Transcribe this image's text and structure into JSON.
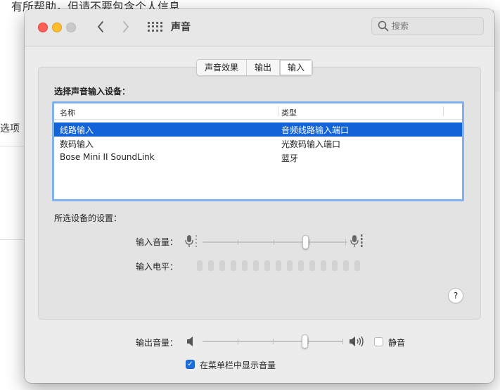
{
  "background": {
    "top_text": "有所帮助，但请不要包含个人信息",
    "left_text": "选项"
  },
  "window": {
    "title": "声音",
    "search_placeholder": "搜索"
  },
  "tabs": [
    {
      "label": "声音效果",
      "active": false
    },
    {
      "label": "输出",
      "active": false
    },
    {
      "label": "输入",
      "active": true
    }
  ],
  "input": {
    "device_prompt": "选择声音输入设备：",
    "columns": [
      "名称",
      "类型"
    ],
    "devices": [
      {
        "name": "线路输入",
        "type": "音频线路输入端口",
        "selected": true
      },
      {
        "name": "数码输入",
        "type": "光数码输入端口",
        "selected": false
      },
      {
        "name": "Bose Mini II SoundLink",
        "type": "蓝牙",
        "selected": false
      }
    ],
    "settings_label": "所选设备的设置：",
    "volume_label": "输入音量：",
    "volume_level": 0.72,
    "level_label": "输入电平：",
    "level_active_bars": 0,
    "level_bar_count": 15
  },
  "help_label": "?",
  "output": {
    "volume_label": "输出音量：",
    "volume_level": 0.74,
    "mute_label": "静音",
    "mute_checked": false,
    "menubar_label": "在菜单栏中显示音量",
    "menubar_checked": true
  },
  "colors": {
    "selection": "#1363d8",
    "focus_ring": "#7fb1ee",
    "close": "#fe5f57",
    "minimize": "#febc2e",
    "checkbox": "#1a6fe0"
  },
  "icons": {
    "back": "chevron-left-icon",
    "forward": "chevron-right-icon",
    "show_all": "grid-icon",
    "search": "search-icon",
    "mic_low": "microphone-low-icon",
    "mic_high": "microphone-high-icon",
    "speaker_low": "speaker-low-icon",
    "speaker_high": "speaker-high-icon"
  }
}
